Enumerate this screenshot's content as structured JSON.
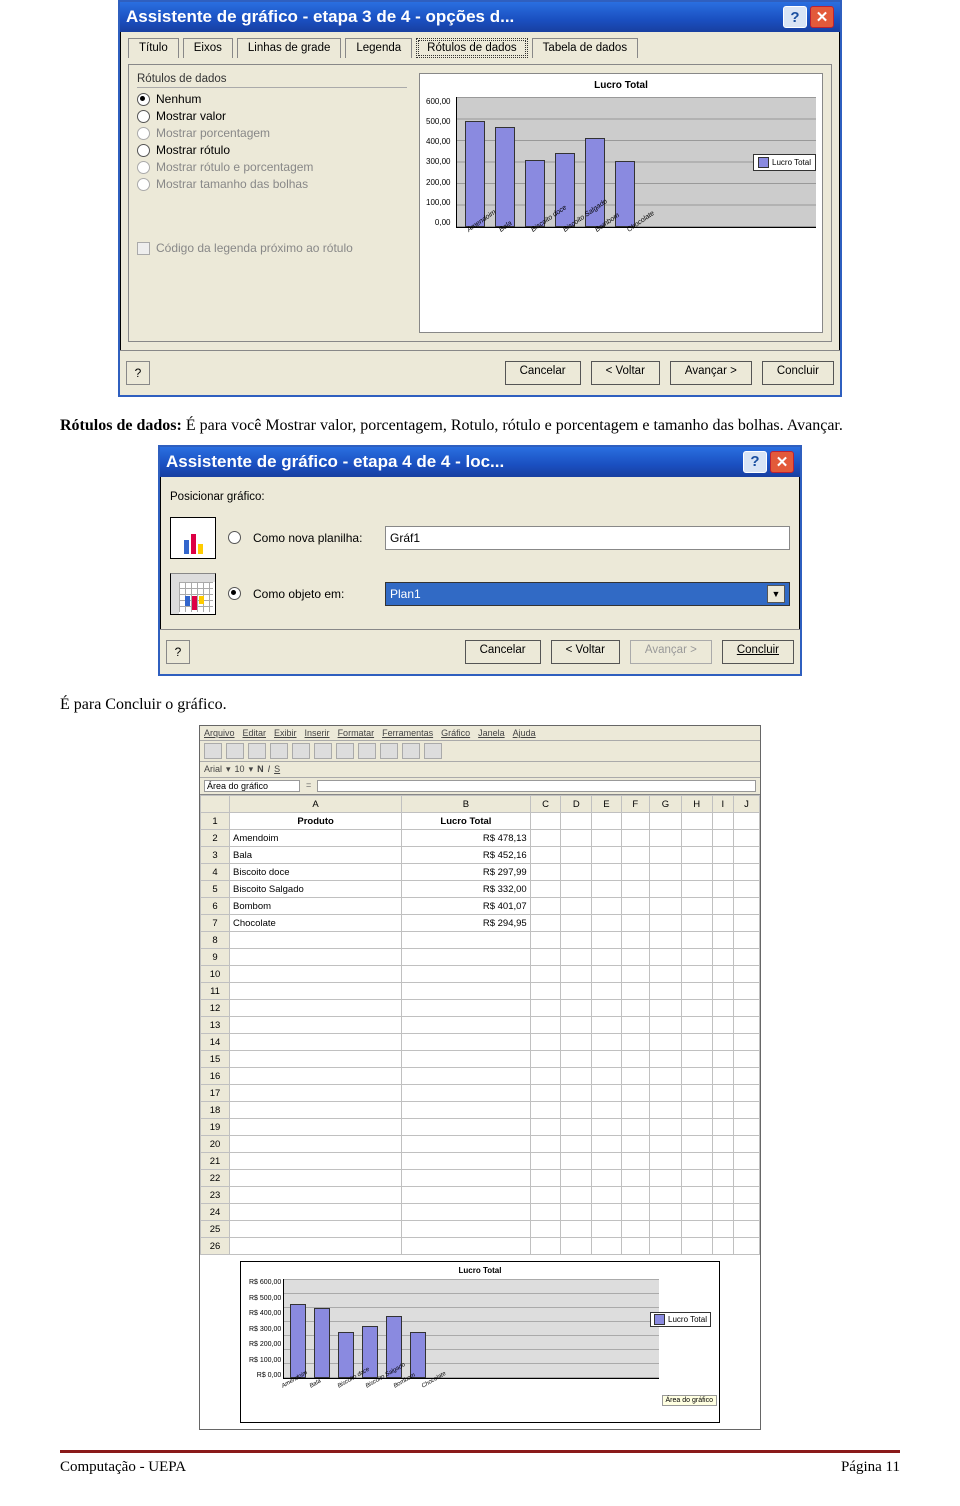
{
  "dialog3": {
    "title": "Assistente de gráfico - etapa 3 de 4 - opções d...",
    "tabs": [
      "Título",
      "Eixos",
      "Linhas de grade",
      "Legenda",
      "Rótulos de dados",
      "Tabela de dados"
    ],
    "active_tab": 4,
    "group_title": "Rótulos de dados",
    "radios": [
      {
        "label": "Nenhum",
        "enabled": true,
        "checked": true
      },
      {
        "label": "Mostrar valor",
        "enabled": true,
        "checked": false
      },
      {
        "label": "Mostrar porcentagem",
        "enabled": false,
        "checked": false
      },
      {
        "label": "Mostrar rótulo",
        "enabled": true,
        "checked": false
      },
      {
        "label": "Mostrar rótulo e porcentagem",
        "enabled": false,
        "checked": false
      },
      {
        "label": "Mostrar tamanho das bolhas",
        "enabled": false,
        "checked": false
      }
    ],
    "legend_checkbox": "Código da legenda próximo ao rótulo",
    "buttons": {
      "cancel": "Cancelar",
      "back": "< Voltar",
      "next": "Avançar >",
      "finish": "Concluir"
    }
  },
  "body_text1_strong": "Rótulos de dados:",
  "body_text1_rest": " É para você Mostrar valor, porcentagem, Rotulo, rótulo e porcentagem e tamanho das bolhas. Avançar.",
  "dialog4": {
    "title": "Assistente de gráfico - etapa 4 de 4 - loc...",
    "group_title": "Posicionar gráfico:",
    "opt1_label": "Como nova planilha:",
    "opt1_value": "Gráf1",
    "opt2_label": "Como objeto em:",
    "opt2_value": "Plan1",
    "buttons": {
      "cancel": "Cancelar",
      "back": "< Voltar",
      "next": "Avançar >",
      "finish": "Concluir"
    }
  },
  "body_text2": "É para Concluir o gráfico.",
  "excel": {
    "menus": [
      "Arquivo",
      "Editar",
      "Exibir",
      "Inserir",
      "Formatar",
      "Ferramentas",
      "Gráfico",
      "Janela",
      "Ajuda"
    ],
    "font_name": "Arial",
    "font_size": "10",
    "namebox": "Área do gráfico",
    "cols": [
      "A",
      "B",
      "C",
      "D",
      "E",
      "F",
      "G",
      "H",
      "I",
      "J"
    ],
    "headers": {
      "A": "Produto",
      "B": "Lucro Total"
    },
    "rows": [
      {
        "A": "Amendoim",
        "B": "R$ 478,13"
      },
      {
        "A": "Bala",
        "B": "R$ 452,16"
      },
      {
        "A": "Biscoito doce",
        "B": "R$ 297,99"
      },
      {
        "A": "Biscoito Salgado",
        "B": "R$ 332,00"
      },
      {
        "A": "Bombom",
        "B": "R$ 401,07"
      },
      {
        "A": "Chocolate",
        "B": "R$ 294,95"
      }
    ],
    "area_label": "Área do gráfico"
  },
  "chart_data": {
    "type": "bar",
    "title": "Lucro Total",
    "legend": "Lucro Total",
    "categories": [
      "Amendoim",
      "Bala",
      "Biscoito doce",
      "Biscoito Salgado",
      "Bombom",
      "Chocolate"
    ],
    "values": [
      478.13,
      452.16,
      297.99,
      332.0,
      401.07,
      294.95
    ],
    "y_ticks": [
      "600,00",
      "500,00",
      "400,00",
      "300,00",
      "200,00",
      "100,00",
      "0,00"
    ],
    "y_ticks_rs": [
      "R$ 600,00",
      "R$ 500,00",
      "R$ 400,00",
      "R$ 300,00",
      "R$ 200,00",
      "R$ 100,00",
      "R$ 0,00"
    ],
    "ylim": [
      0,
      600
    ]
  },
  "footer": {
    "left": "Computação - UEPA",
    "right": "Página 11"
  }
}
